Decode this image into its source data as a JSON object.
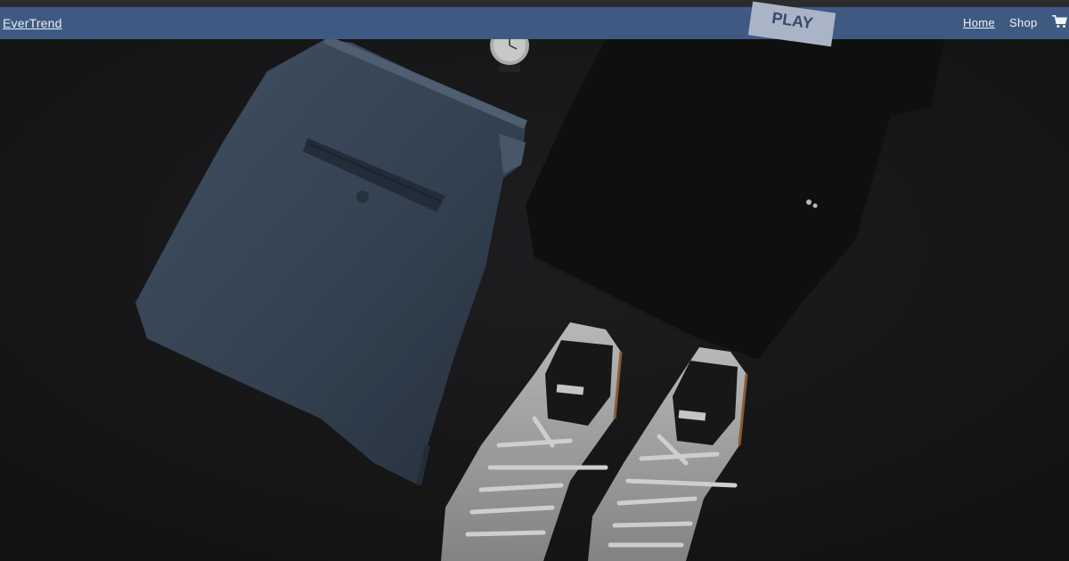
{
  "navbar": {
    "brand": "EverTrend",
    "links": [
      "Home",
      "Shop"
    ],
    "cart_icon": "shopping-cart-icon",
    "background": "#3f5a82"
  },
  "hero": {
    "tag_text": "PLAY",
    "items": [
      "trousers",
      "wristwatch",
      "black-tshirt",
      "white-sneakers"
    ]
  }
}
